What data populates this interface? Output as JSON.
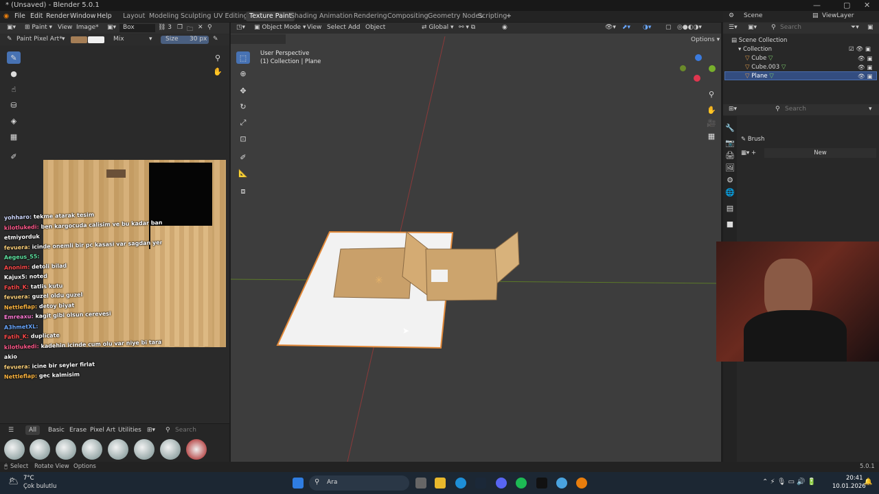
{
  "window": {
    "title": "* (Unsaved) - Blender 5.0.1"
  },
  "menu": [
    "File",
    "Edit",
    "Render",
    "Window",
    "Help"
  ],
  "workspaces": [
    "Layout",
    "Modeling",
    "Sculpting",
    "UV Editing",
    "Texture Paint",
    "Shading",
    "Animation",
    "Rendering",
    "Compositing",
    "Geometry Nodes",
    "Scripting"
  ],
  "image_editor": {
    "mode": "Paint",
    "view": "View",
    "image": "Image*",
    "image_name": "Box",
    "users": "3",
    "brush": "Paint Pixel Art*",
    "blend": "Mix",
    "size_label": "Size",
    "size_value": "30 px"
  },
  "chat": [
    {
      "user": "yohharo:",
      "msg": "tekme atarak tesim",
      "color": "#cfd9ff"
    },
    {
      "user": "kilotlukedi:",
      "msg": "ben kargocuda calisim ve bu kadar bant yok",
      "color": "#ff5a8c"
    },
    {
      "user": "",
      "msg": "etmiyorduk",
      "color": "#ffffff"
    },
    {
      "user": "fevuera:",
      "msg": "icinde onemli bir pc kasasi var sagdan yere at",
      "color": "#ffd27a"
    },
    {
      "user": "Aegeus_55:",
      "msg": "",
      "color": "#5fe3a1"
    },
    {
      "user": "Anonim:",
      "msg": "detoli bilad",
      "color": "#ff4b4b"
    },
    {
      "user": "Kajux5:",
      "msg": "noted",
      "color": "#ffffff"
    },
    {
      "user": "Fatih_K:",
      "msg": "tatlis kutu",
      "color": "#ff4b4b"
    },
    {
      "user": "fevuera:",
      "msg": "guzel oldu guzel",
      "color": "#ffd27a"
    },
    {
      "user": "Nettleflap:",
      "msg": "detoy biyat",
      "color": "#ffb640"
    },
    {
      "user": "Emreaxu:",
      "msg": "kagit gibi olsun cerevesi",
      "color": "#ff7ad6"
    },
    {
      "user": "A3hmetXL:",
      "msg": "",
      "color": "#6aa8ff"
    },
    {
      "user": "Fatih_K:",
      "msg": "duplicate",
      "color": "#ff4b4b"
    },
    {
      "user": "kilotlukedi:",
      "msg": "kadehin icinde cum olu var niye bi taraftan bi sey",
      "color": "#ff5a8c"
    },
    {
      "user": "",
      "msg": "akio",
      "color": "#ffffff"
    },
    {
      "user": "fevuera:",
      "msg": "icine bir seyler firlat",
      "color": "#ffd27a"
    },
    {
      "user": "Nettleflap:",
      "msg": "gec kalmisim",
      "color": "#ffb640"
    }
  ],
  "asset_tabs": [
    "All",
    "Basic",
    "Erase",
    "Pixel Art",
    "Utilities"
  ],
  "asset_search_placeholder": "Search",
  "viewport": {
    "mode": "Object Mode",
    "menus": [
      "View",
      "Select",
      "Add",
      "Object"
    ],
    "orientation": "Global",
    "options": "Options",
    "overlay_title": "User Perspective",
    "overlay_sub": "(1) Collection | Plane"
  },
  "outliner": {
    "scene": "Scene",
    "view_layer": "ViewLayer",
    "search_placeholder": "Search",
    "root": "Scene Collection",
    "collection": "Collection",
    "items": [
      "Cube",
      "Cube.003",
      "Plane"
    ]
  },
  "properties": {
    "search_placeholder": "Search",
    "panel": "Brush",
    "new_label": "New"
  },
  "statusbar": {
    "select": "Select",
    "rotate": "Rotate View",
    "options": "Options",
    "version": "5.0.1"
  },
  "taskbar": {
    "weather_temp": "7°C",
    "weather_desc": "Çok bulutlu",
    "search": "Ara",
    "time": "20:41",
    "date": "10.01.2026"
  }
}
